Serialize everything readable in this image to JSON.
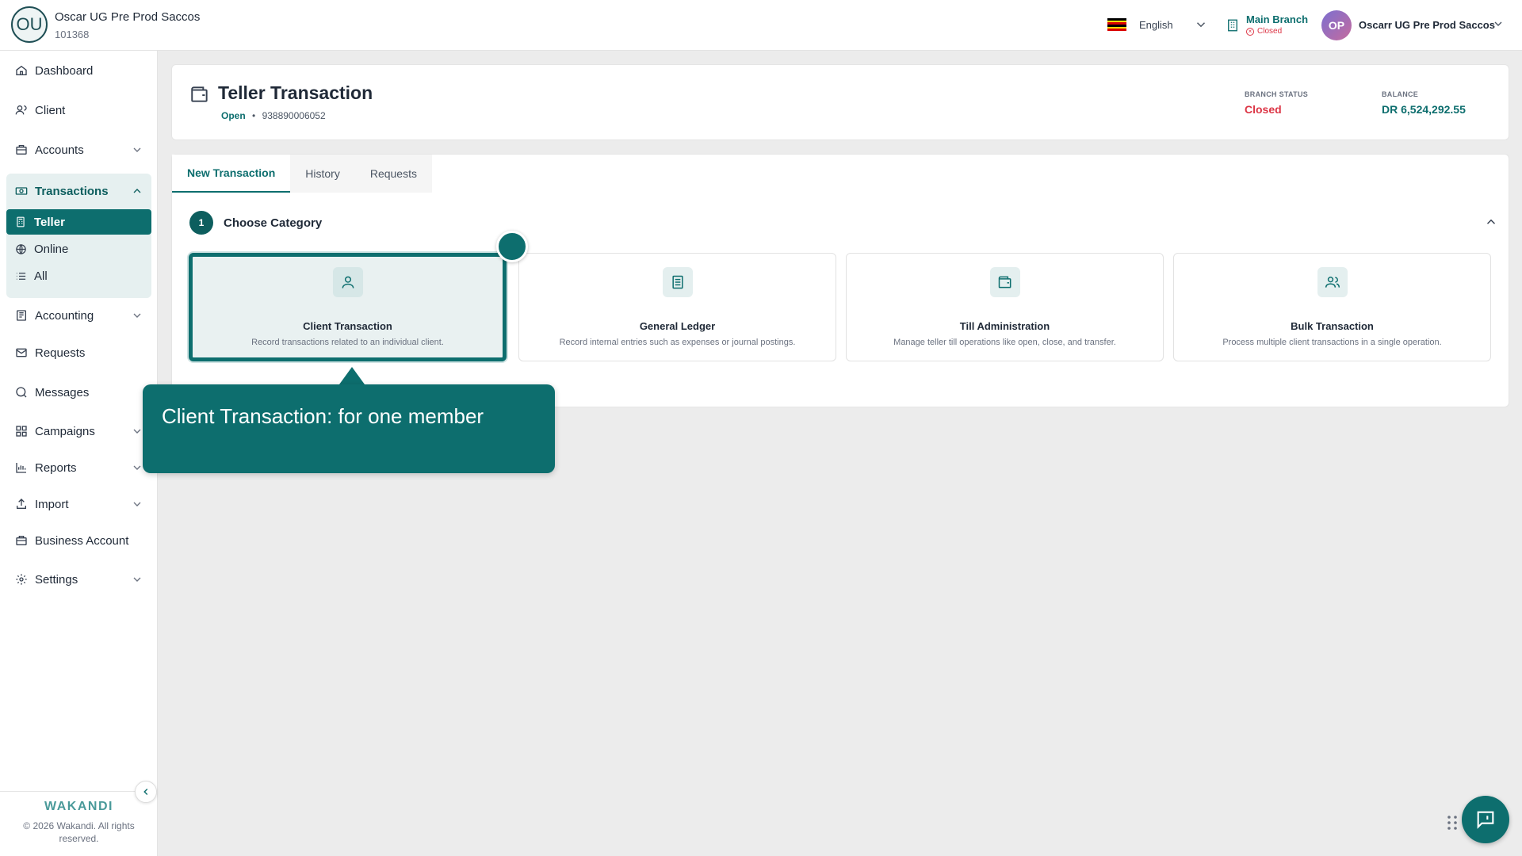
{
  "org": {
    "initials": "OU",
    "name": "Oscar UG Pre Prod Saccos",
    "id": "101368"
  },
  "topbar": {
    "language": "English",
    "branch_name": "Main Branch",
    "branch_status": "Closed",
    "user_initials": "OP",
    "user_name": "Oscarr UG Pre Prod Saccos"
  },
  "sidebar": {
    "items": [
      {
        "label": "Dashboard",
        "icon": "home-icon"
      },
      {
        "label": "Client",
        "icon": "users-icon"
      },
      {
        "label": "Accounts",
        "icon": "accounts-icon"
      },
      {
        "label": "Transactions",
        "icon": "transactions-icon"
      },
      {
        "label": "Accounting",
        "icon": "accounting-icon"
      },
      {
        "label": "Requests",
        "icon": "mail-icon"
      },
      {
        "label": "Messages",
        "icon": "message-icon"
      },
      {
        "label": "Campaigns",
        "icon": "grid-icon"
      },
      {
        "label": "Reports",
        "icon": "chart-icon"
      },
      {
        "label": "Import",
        "icon": "upload-icon"
      },
      {
        "label": "Business Account",
        "icon": "briefcase-icon"
      },
      {
        "label": "Settings",
        "icon": "gear-icon"
      }
    ],
    "transaction_sub": [
      {
        "label": "Teller",
        "active": true
      },
      {
        "label": "Online"
      },
      {
        "label": "All"
      }
    ],
    "brand": "WAKANDI",
    "copyright": "© 2026 Wakandi. All rights reserved."
  },
  "header": {
    "title": "Teller Transaction",
    "status": "Open",
    "separator": "•",
    "till_number": "938890006052",
    "branch_status_label": "BRANCH STATUS",
    "branch_status_value": "Closed",
    "balance_label": "BALANCE",
    "balance_value": "DR 6,524,292.55"
  },
  "tabs": [
    "New Transaction",
    "History",
    "Requests"
  ],
  "step": {
    "number": "1",
    "title": "Choose Category"
  },
  "categories": [
    {
      "title": "Client Transaction",
      "desc": "Record transactions related to an individual client.",
      "icon": "person-icon",
      "selected": true
    },
    {
      "title": "General Ledger",
      "desc": "Record internal entries such as expenses or journal postings.",
      "icon": "ledger-icon"
    },
    {
      "title": "Till Administration",
      "desc": "Manage teller till operations like open, close, and transfer.",
      "icon": "wallet-icon"
    },
    {
      "title": "Bulk Transaction",
      "desc": "Process multiple client transactions in a single operation.",
      "icon": "group-icon"
    }
  ],
  "tooltip": {
    "text": "Client Transaction: for one member"
  },
  "colors": {
    "primary": "#0d6e6e",
    "danger": "#dc3545",
    "background": "#ececec"
  }
}
